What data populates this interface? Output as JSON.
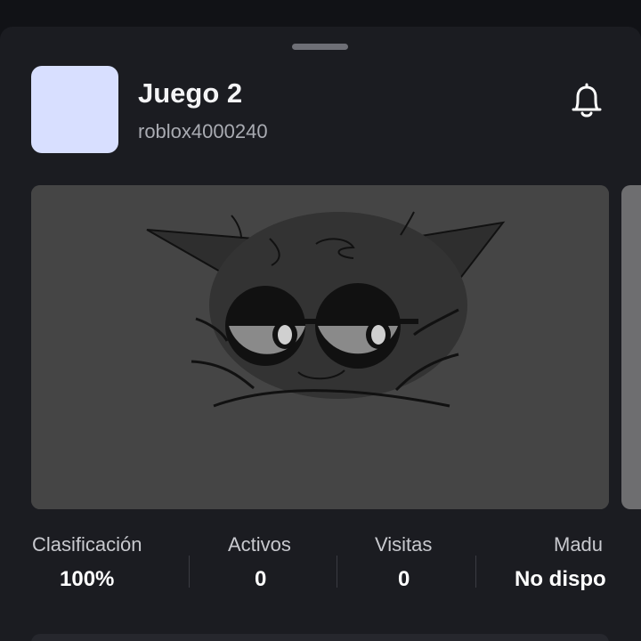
{
  "game": {
    "title": "Juego 2",
    "creator": "roblox4000240",
    "thumbnail_color": "#d8dfff"
  },
  "icons": {
    "notify": "bell-icon"
  },
  "stats": [
    {
      "label": "Clasificación",
      "value": "100%"
    },
    {
      "label": "Activos",
      "value": "0"
    },
    {
      "label": "Visitas",
      "value": "0"
    },
    {
      "label": "Madu",
      "value": "No dispo"
    }
  ],
  "colors": {
    "background": "#1b1c21",
    "media_background": "#454545",
    "text_primary": "#ffffff",
    "text_secondary": "#a9abb2"
  }
}
